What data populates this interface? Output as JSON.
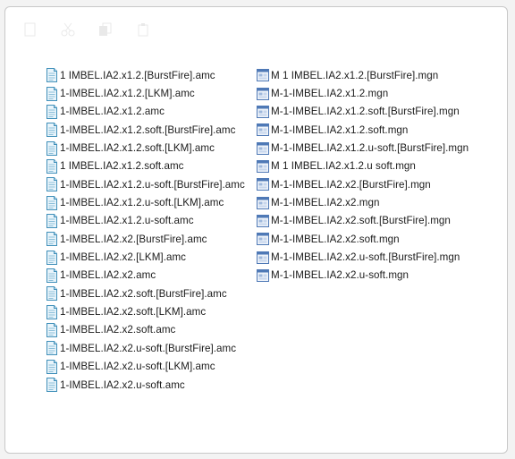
{
  "toolbar": {
    "icons": [
      "new-icon",
      "cut-icon",
      "copy-icon",
      "paste-icon"
    ]
  },
  "files_amc": [
    "1 IMBEL.IA2.x1.2.[BurstFire].amc",
    "1-IMBEL.IA2.x1.2.[LKM].amc",
    "1-IMBEL.IA2.x1.2.amc",
    "1-IMBEL.IA2.x1.2.soft.[BurstFire].amc",
    "1-IMBEL.IA2.x1.2.soft.[LKM].amc",
    "1 IMBEL.IA2.x1.2.soft.amc",
    "1-IMBEL.IA2.x1.2.u-soft.[BurstFire].amc",
    "1-IMBEL.IA2.x1.2.u-soft.[LKM].amc",
    "1-IMBEL.IA2.x1.2.u-soft.amc",
    "1-IMBEL.IA2.x2.[BurstFire].amc",
    "1-IMBEL.IA2.x2.[LKM].amc",
    "1-IMBEL.IA2.x2.amc",
    "1-IMBEL.IA2.x2.soft.[BurstFire].amc",
    "1-IMBEL.IA2.x2.soft.[LKM].amc",
    "1-IMBEL.IA2.x2.soft.amc",
    "1-IMBEL.IA2.x2.u-soft.[BurstFire].amc",
    "1-IMBEL.IA2.x2.u-soft.[LKM].amc",
    "1-IMBEL.IA2.x2.u-soft.amc"
  ],
  "files_mgn": [
    "M 1 IMBEL.IA2.x1.2.[BurstFire].mgn",
    "M-1-IMBEL.IA2.x1.2.mgn",
    "M-1-IMBEL.IA2.x1.2.soft.[BurstFire].mgn",
    "M-1-IMBEL.IA2.x1.2.soft.mgn",
    "M-1-IMBEL.IA2.x1.2.u-soft.[BurstFire].mgn",
    "M 1 IMBEL.IA2.x1.2.u soft.mgn",
    "M-1-IMBEL.IA2.x2.[BurstFire].mgn",
    "M-1-IMBEL.IA2.x2.mgn",
    "M-1-IMBEL.IA2.x2.soft.[BurstFire].mgn",
    "M-1-IMBEL.IA2.x2.soft.mgn",
    "M-1-IMBEL.IA2.x2.u-soft.[BurstFire].mgn",
    "M-1-IMBEL.IA2.x2.u-soft.mgn"
  ],
  "colors": {
    "amc_icon": "#3f8fb9",
    "mgn_icon": "#4f79b6"
  }
}
